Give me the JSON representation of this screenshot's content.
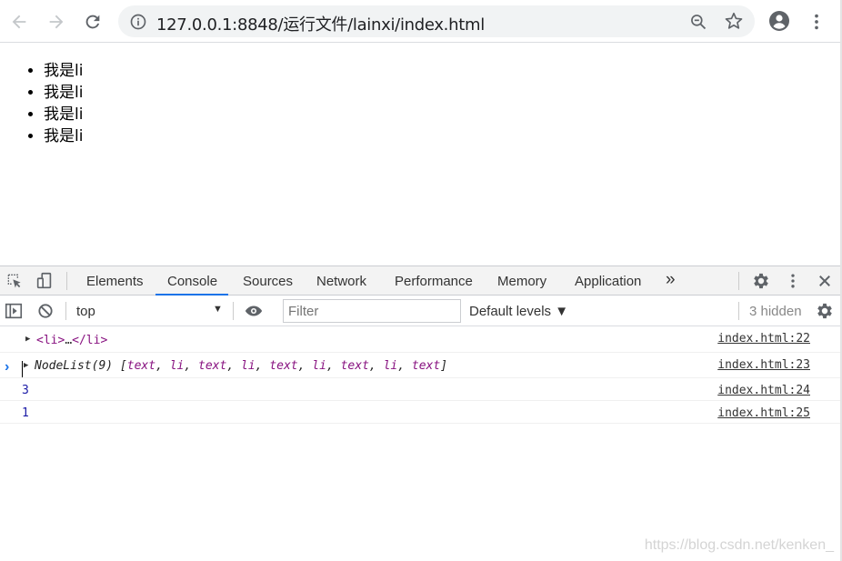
{
  "browser": {
    "url": "127.0.0.1:8848/运行文件/lainxi/index.html",
    "icons": {
      "back": "arrow-left-icon",
      "forward": "arrow-right-icon",
      "reload": "reload-icon",
      "info": "info-icon",
      "zoom": "zoom-out-icon",
      "star": "star-icon",
      "profile": "account-icon",
      "menu": "vertical-dots-icon"
    }
  },
  "page": {
    "list_items": [
      "我是li",
      "我是li",
      "我是li",
      "我是li"
    ]
  },
  "devtools": {
    "tabs": [
      {
        "label": "Elements"
      },
      {
        "label": "Console"
      },
      {
        "label": "Sources"
      },
      {
        "label": "Network"
      },
      {
        "label": "Performance"
      },
      {
        "label": "Memory"
      },
      {
        "label": "Application"
      }
    ],
    "more_tabs": "»",
    "active_tab": "Console",
    "accent_color": "#1a73e8",
    "context": "top",
    "filter_placeholder": "Filter",
    "levels": "Default levels ▼",
    "hidden": "3 hidden",
    "messages": {
      "m1": {
        "open": "<li>",
        "ellipsis": "…",
        "close": "</li>",
        "source": "index.html:22"
      },
      "m2": {
        "prefix": "NodeList(9) [",
        "items": [
          "text",
          "li",
          "text",
          "li",
          "text",
          "li",
          "text",
          "li",
          "text"
        ],
        "suffix": "]",
        "source": "index.html:23"
      },
      "m3": {
        "value": "3",
        "source": "index.html:24"
      },
      "m4": {
        "value": "1",
        "source": "index.html:25"
      }
    }
  },
  "watermark": "https://blog.csdn.net/kenken_"
}
